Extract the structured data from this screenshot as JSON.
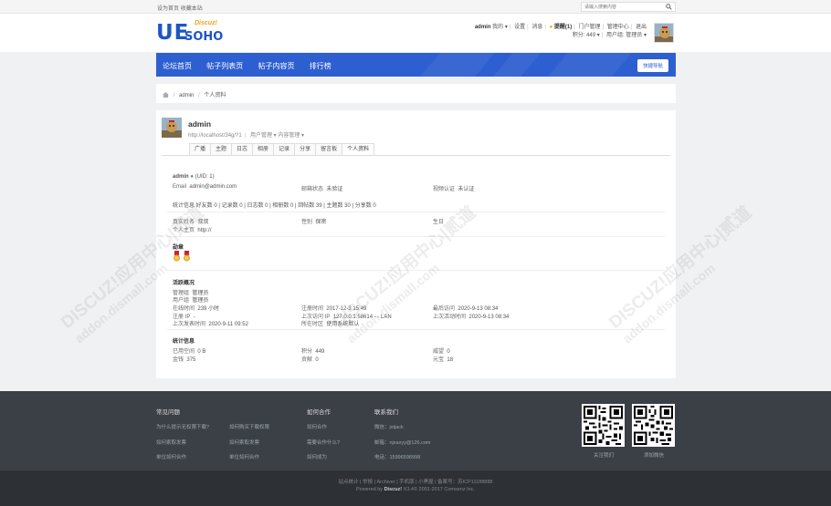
{
  "topbar": {
    "links": [
      "设为首页",
      "收藏本站"
    ],
    "search_placeholder": "请输入搜索内容"
  },
  "logo": {
    "main": "UE",
    "sub": "SOHO",
    "tag": "Discuz!"
  },
  "user": {
    "name": "admin",
    "line1": [
      "我的",
      "设置",
      "消息",
      "提醒(1)",
      "门户管理",
      "管理中心",
      "退出"
    ],
    "points": "积分: 449",
    "group": "用户组: 管理员"
  },
  "nav": {
    "items": [
      "论坛首页",
      "帖子列表页",
      "帖子内容页",
      "排行榜"
    ],
    "quick": "快捷导航"
  },
  "breadcrumb": {
    "items": [
      "admin",
      "个人资料"
    ]
  },
  "profile": {
    "name": "admin",
    "url": "http://localhost/34g/?1",
    "menus": [
      "用户管理",
      "内容管理"
    ],
    "tabs": [
      "广播",
      "主题",
      "日志",
      "相册",
      "记录",
      "分享",
      "留言板",
      "个人资料"
    ],
    "uid_line": "admin",
    "uid": "(UID: 1)",
    "email_label": "Email",
    "email": "admin@admin.com",
    "mail_status_label": "邮箱状态",
    "mail_status": "未验证",
    "video_label": "视频认证",
    "video": "未认证",
    "stats": "统计信息  好友数 0  |  记录数 0  |  日志数 0  |  相册数 0  |  回帖数 39  |  主题数 30  |  分享数 0",
    "realname_label": "真实姓名",
    "realname": "叔叔",
    "gender_label": "性别",
    "gender": "保密",
    "birthday_label": "生日",
    "birthday": "",
    "homepage_label": "个人主页",
    "homepage": "http://",
    "medal_title": "勋章",
    "activity_title": "活跃概况",
    "admin_group_label": "管理组",
    "admin_group": "管理员",
    "user_group_label": "用户组",
    "user_group": "管理员",
    "online_label": "在线时间",
    "online": "239 小时",
    "reg_ip_label": "注册 IP",
    "reg_ip": "-",
    "last_post_label": "上次发表时间",
    "last_post": "2020-9-11 09:52",
    "reg_time_label": "注册时间",
    "reg_time": "2017-12-3 15:49",
    "last_ip_label": "上次访问 IP",
    "last_ip": "127.0.0.1:58614 - - LAN",
    "region_label": "所在时区",
    "region": "使用系统默认",
    "last_visit_label": "最后访问",
    "last_visit": "2020-9-13 08:34",
    "last_active_label": "上次活动时间",
    "last_active": "2020-9-13 08:34",
    "stat_title": "统计信息",
    "space_label": "已用空间",
    "space": "0 B",
    "coins_label": "金钱",
    "coins": "375",
    "credits_label": "积分",
    "credits": "449",
    "contrib_label": "贡献",
    "contrib": "0",
    "prestige_label": "威望",
    "prestige": "0",
    "yuanbao_label": "元宝",
    "yuanbao": "18"
  },
  "footer": {
    "faq_title": "常见问题",
    "faq_links": [
      "为什么提示无权限下载?",
      "如何购买下载权限",
      "如何索取发票",
      "如何索取发票",
      "单位如何合作",
      "单位如何合作"
    ],
    "coop_title": "如何合作",
    "coop_links": [
      "如何合作",
      "需要合作什么?",
      "如何成为"
    ],
    "contact_title": "联系我们",
    "contact_links": [
      "微信：jxtjack",
      "邮箱：njxaxyy@126.com",
      "电话：15996598998"
    ],
    "qr_labels": [
      "关注我们",
      "添加微信"
    ],
    "bottom_line1": "站点统计  |  举报  |  Archiver  |  手机版  |  小黑屋  |  备案号：苏ICP11188888",
    "bottom_line2_pre": "Powered by",
    "bottom_brand": "Discuz!",
    "bottom_line2_post": "X3.4© 2001-2017 Comsenz Inc."
  },
  "watermark": {
    "big": "DISCUZ!应用中心|贰道",
    "small": "addon.dismall.com"
  },
  "colors": {
    "nav": "#2e5fd0",
    "footer": "#3b3f46",
    "bottom": "#2d3035",
    "logo": "#1e56c5"
  }
}
